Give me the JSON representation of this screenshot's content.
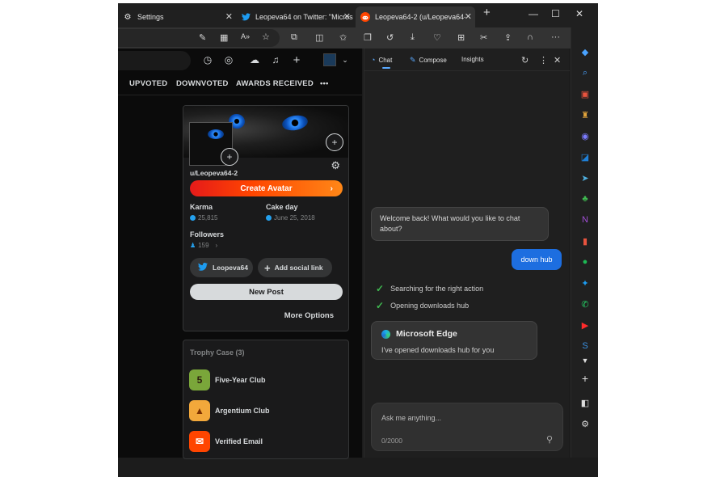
{
  "browser": {
    "tabs": [
      {
        "title": "Settings",
        "icon": "gear-icon"
      },
      {
        "title": "Leopeva64 on Twitter: \"Micros",
        "icon": "twitter-icon"
      },
      {
        "title": "Leopeva64-2 (u/Leopeva64-2)",
        "icon": "reddit-icon"
      }
    ]
  },
  "reddit": {
    "profile_tabs": [
      "UPVOTED",
      "DOWNVOTED",
      "AWARDS RECEIVED",
      "•••"
    ],
    "username": "u/Leopeva64-2",
    "create_avatar": "Create Avatar",
    "karma_label": "Karma",
    "karma_value": "25,815",
    "cakeday_label": "Cake day",
    "cakeday_value": "June 25, 2018",
    "followers_label": "Followers",
    "followers_value": "159",
    "twitter_link": "Leopeva64",
    "add_social": "Add social link",
    "new_post": "New Post",
    "more_options": "More Options",
    "trophy_title": "Trophy Case (3)",
    "trophies": [
      "Five-Year Club",
      "Argentium Club",
      "Verified Email"
    ]
  },
  "sidebar": {
    "tabs": {
      "chat": "Chat",
      "compose": "Compose",
      "insights": "Insights"
    },
    "welcome": "Welcome back! What would you like to chat about?",
    "user_msg": "down hub",
    "status1": "Searching for the right action",
    "status2": "Opening downloads hub",
    "edge_title": "Microsoft Edge",
    "edge_msg": "I've opened downloads hub for you",
    "input_placeholder": "Ask me anything...",
    "char_count": "0/2000"
  }
}
